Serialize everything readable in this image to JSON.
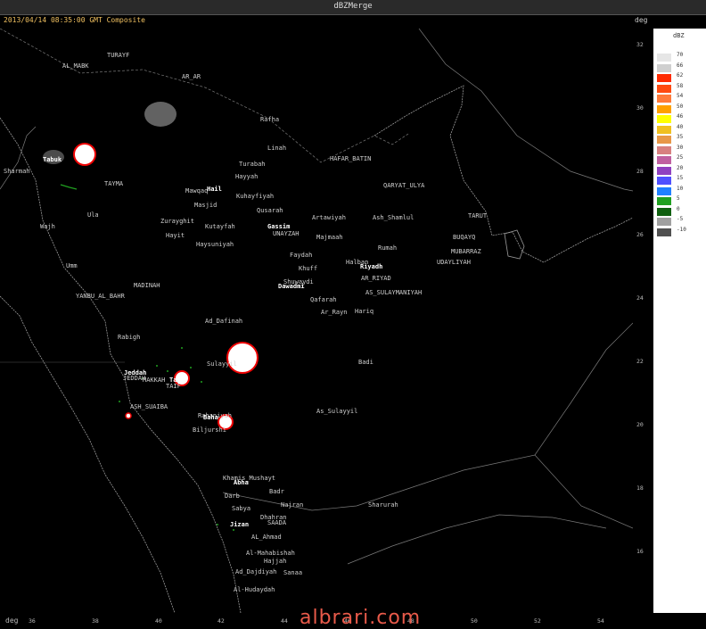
{
  "window_title": "dBZMerge",
  "timestamp": "2013/04/14 08:35:00 GMT Composite",
  "axis_unit": "deg",
  "bottom_axis_unit": "deg",
  "lat_ticks": [
    "32",
    "30",
    "28",
    "26",
    "24",
    "22",
    "20",
    "18",
    "16"
  ],
  "lon_ticks": [
    "36",
    "38",
    "40",
    "42",
    "44",
    "46",
    "48",
    "50",
    "52",
    "54"
  ],
  "legend": {
    "title": "dBZ",
    "labels": [
      "70",
      "66",
      "62",
      "58",
      "54",
      "50",
      "46",
      "40",
      "35",
      "30",
      "25",
      "20",
      "15",
      "10",
      "5",
      "0",
      "-5",
      "-10"
    ],
    "colors": [
      "#e6e6e6",
      "#cfcfcf",
      "#ff2a00",
      "#ff4a10",
      "#ff7a3a",
      "#ffa000",
      "#ffff00",
      "#f0c020",
      "#e89848",
      "#d88080",
      "#c060a0",
      "#9040c0",
      "#5050ff",
      "#2080ff",
      "#20a020",
      "#106010",
      "#a0a0a0",
      "#505050"
    ]
  },
  "cities": [
    {
      "name": "AL_MABK",
      "bold": false
    },
    {
      "name": "TURAYF",
      "bold": false
    },
    {
      "name": "AR_AR",
      "bold": false
    },
    {
      "name": "Rafha",
      "bold": false
    },
    {
      "name": "Tabuk",
      "bold": true
    },
    {
      "name": "Linah",
      "bold": false
    },
    {
      "name": "Turabah",
      "bold": false
    },
    {
      "name": "HAFAR_BATIN",
      "bold": false
    },
    {
      "name": "Sharmah",
      "bold": false
    },
    {
      "name": "Hayyah",
      "bold": false
    },
    {
      "name": "TAYMA",
      "bold": false
    },
    {
      "name": "Mawqaq",
      "bold": false
    },
    {
      "name": "Hail",
      "bold": true
    },
    {
      "name": "Kuhayfiyah",
      "bold": false
    },
    {
      "name": "QARYAT_ULYA",
      "bold": false
    },
    {
      "name": "Masjid",
      "bold": false
    },
    {
      "name": "Qusarah",
      "bold": false
    },
    {
      "name": "Ula",
      "bold": false
    },
    {
      "name": "Zurayghit",
      "bold": false
    },
    {
      "name": "Artawiyah",
      "bold": false
    },
    {
      "name": "Ash_Shamlul",
      "bold": false
    },
    {
      "name": "TARUT",
      "bold": false
    },
    {
      "name": "Wajh",
      "bold": false
    },
    {
      "name": "Kutayfah",
      "bold": false
    },
    {
      "name": "Gassim",
      "bold": true
    },
    {
      "name": "UNAYZAH",
      "bold": false
    },
    {
      "name": "Hayit",
      "bold": false
    },
    {
      "name": "Majmaah",
      "bold": false
    },
    {
      "name": "BUQAYQ",
      "bold": false
    },
    {
      "name": "Haysuniyah",
      "bold": false
    },
    {
      "name": "Rumah",
      "bold": false
    },
    {
      "name": "MUBARRAZ",
      "bold": false
    },
    {
      "name": "Faydah",
      "bold": false
    },
    {
      "name": "UDAYLIYAH",
      "bold": false
    },
    {
      "name": "Halban",
      "bold": false
    },
    {
      "name": "Riyadh",
      "bold": true
    },
    {
      "name": "Umm",
      "bold": false
    },
    {
      "name": "Khuff",
      "bold": false
    },
    {
      "name": "AR_RIYAD",
      "bold": false
    },
    {
      "name": "Shuwaydi",
      "bold": false
    },
    {
      "name": "Dawadmi",
      "bold": true
    },
    {
      "name": "MADINAH",
      "bold": false
    },
    {
      "name": "AS_SULAYMANIYAH",
      "bold": false
    },
    {
      "name": "YANBU_AL_BAHR",
      "bold": false
    },
    {
      "name": "Qafarah",
      "bold": false
    },
    {
      "name": "Ar_Rayn",
      "bold": false
    },
    {
      "name": "Hariq",
      "bold": false
    },
    {
      "name": "Ad_Dafinah",
      "bold": false
    },
    {
      "name": "Rabigh",
      "bold": false
    },
    {
      "name": "Badi",
      "bold": false
    },
    {
      "name": "Sulayyil",
      "bold": false
    },
    {
      "name": "Jeddah",
      "bold": true
    },
    {
      "name": "JEDDAH",
      "bold": false
    },
    {
      "name": "MAKKAH",
      "bold": false
    },
    {
      "name": "Taif",
      "bold": true
    },
    {
      "name": "TAIF",
      "bold": false
    },
    {
      "name": "ASH_SUAIBA",
      "bold": false
    },
    {
      "name": "As_Sulayyil",
      "bold": false
    },
    {
      "name": "Rahaniyah",
      "bold": false
    },
    {
      "name": "Baha",
      "bold": true
    },
    {
      "name": "Biljurshi",
      "bold": false
    },
    {
      "name": "Khamis_Mushayt",
      "bold": false
    },
    {
      "name": "Abha",
      "bold": true
    },
    {
      "name": "Badr",
      "bold": false
    },
    {
      "name": "Darb",
      "bold": false
    },
    {
      "name": "Najran",
      "bold": false
    },
    {
      "name": "Sharurah",
      "bold": false
    },
    {
      "name": "Sabya",
      "bold": false
    },
    {
      "name": "Dhahran",
      "bold": false
    },
    {
      "name": "Jizan",
      "bold": true
    },
    {
      "name": "SAADA",
      "bold": false
    },
    {
      "name": "AL_Ahmad",
      "bold": false
    },
    {
      "name": "Al-Mahabishah",
      "bold": false
    },
    {
      "name": "Hajjah",
      "bold": false
    },
    {
      "name": "Ad_Dajdiyah",
      "bold": false
    },
    {
      "name": "Sanaa",
      "bold": false
    },
    {
      "name": "Al-Hudaydah",
      "bold": false
    }
  ],
  "watermark": "albrari.com"
}
